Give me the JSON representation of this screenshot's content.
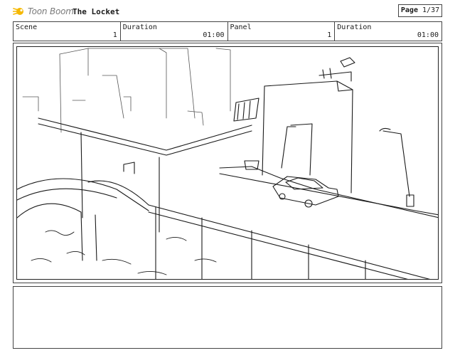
{
  "header": {
    "logo_text": "Toon Boom",
    "title": "The Locket",
    "page_label": "Page",
    "page_value": "1/37"
  },
  "info": {
    "scene_label": "Scene",
    "scene_value": "1",
    "duration1_label": "Duration",
    "duration1_value": "01:00",
    "panel_label": "Panel",
    "panel_value": "1",
    "duration2_label": "Duration",
    "duration2_value": "01:00"
  },
  "colors": {
    "logo_accent": "#f5b800",
    "logo_text": "#7a7a7a",
    "line": "#1a1a1a"
  },
  "icons": {
    "logo": "toon-boom-logo-icon"
  },
  "panel": {
    "content": "sketch"
  },
  "notes": {
    "text": ""
  }
}
